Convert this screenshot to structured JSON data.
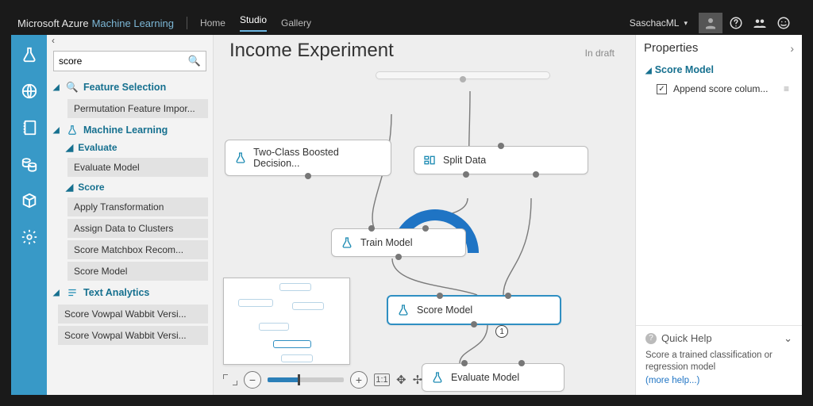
{
  "topbar": {
    "brand1": "Microsoft Azure",
    "brand2": "Machine Learning",
    "links": {
      "home": "Home",
      "studio": "Studio",
      "gallery": "Gallery"
    },
    "user": "SaschacML"
  },
  "search": {
    "value": "score"
  },
  "tree": {
    "feature_selection": "Feature Selection",
    "perm_feat": "Permutation Feature Impor...",
    "machine_learning": "Machine Learning",
    "evaluate": "Evaluate",
    "evaluate_model": "Evaluate Model",
    "score": "Score",
    "apply_transformation": "Apply Transformation",
    "assign_clusters": "Assign Data to Clusters",
    "score_matchbox": "Score Matchbox Recom...",
    "score_model": "Score Model",
    "text_analytics": "Text Analytics",
    "vw1": "Score Vowpal Wabbit Versi...",
    "vw2": "Score Vowpal Wabbit Versi..."
  },
  "experiment": {
    "title": "Income Experiment",
    "status": "In draft"
  },
  "nodes": {
    "boosted": "Two-Class Boosted Decision...",
    "split": "Split Data",
    "train": "Train Model",
    "score": "Score Model",
    "evaluate": "Evaluate Model",
    "badge": "1"
  },
  "zoom": {
    "ratio": "1:1"
  },
  "props": {
    "title": "Properties",
    "section": "Score Model",
    "append": "Append score colum...",
    "quick_help": "Quick Help",
    "desc": "Score a trained classification or regression model",
    "more": "(more help...)"
  }
}
